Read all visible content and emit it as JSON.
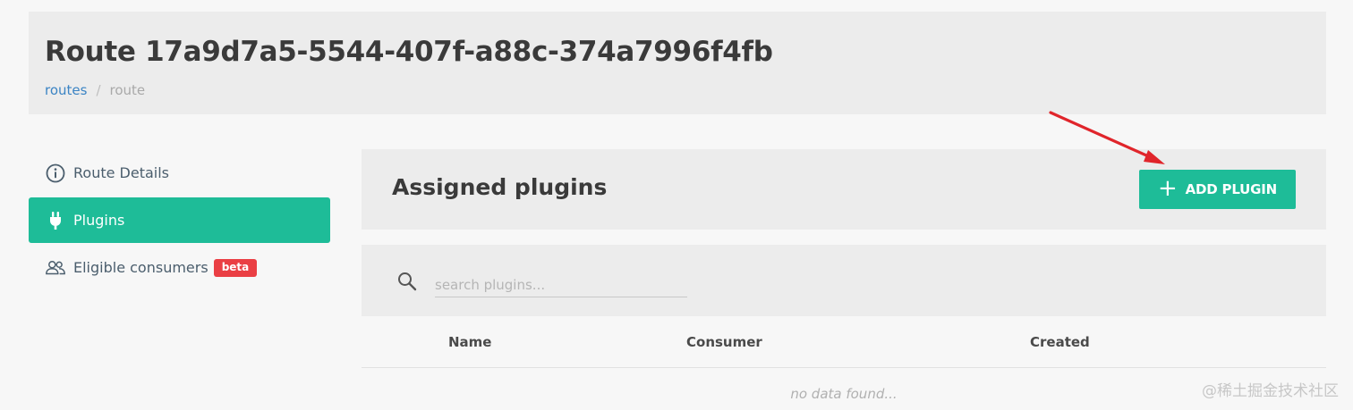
{
  "header": {
    "title": "Route 17a9d7a5-5544-407f-a88c-374a7996f4fb",
    "breadcrumb": {
      "link": "routes",
      "separator": "/",
      "current": "route"
    }
  },
  "sidebar": {
    "items": [
      {
        "label": "Route Details",
        "icon": "info-icon",
        "active": false
      },
      {
        "label": "Plugins",
        "icon": "plug-icon",
        "active": true
      },
      {
        "label": "Eligible consumers",
        "icon": "users-icon",
        "active": false,
        "badge": "beta"
      }
    ]
  },
  "main": {
    "panel_title": "Assigned plugins",
    "add_button": {
      "plus": "+",
      "label": "ADD PLUGIN"
    },
    "search": {
      "placeholder": "search plugins...",
      "value": ""
    },
    "table": {
      "columns": [
        "Name",
        "Consumer",
        "Created"
      ],
      "empty_text": "no data found..."
    }
  },
  "watermark": "@稀土掘金技术社区",
  "colors": {
    "accent": "#1ebc98",
    "badge": "#ea3f44",
    "link": "#3b84c4",
    "annotation_arrow": "#e0252b"
  }
}
